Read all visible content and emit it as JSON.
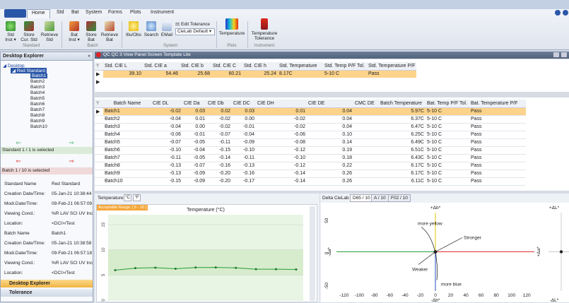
{
  "ribbon": {
    "tabs": [
      "Home",
      "Std",
      "Bat",
      "System",
      "Forms",
      "Plots",
      "Instrument"
    ],
    "buttons": {
      "std_inst": "Std\nInst ▾",
      "store_cur_std": "Store\nCur. Std",
      "retrieve_std": "Retrieve\nStd",
      "bat_inst": "Bat\nInst ▾",
      "store_bat": "Store\nBat",
      "retrieve_bat": "Retrieve\nBat",
      "illu_obs": "Illu/Obs",
      "search": "Search",
      "email": "EMail",
      "edit_tolerance": "Edit Tolerance",
      "cielab_default": "CieLab Default",
      "temperature": "Temperature",
      "temperature_tolerance": "Temperature\nTolerance"
    },
    "groups": [
      "Standard",
      "Batch",
      "System",
      "Plots",
      "Instrument"
    ],
    "colors": {
      "accent": "#2a56a8",
      "selected_row": "#fcd38a",
      "green": "#2a9d3a",
      "red": "#d33"
    }
  },
  "explorer": {
    "title": "Desktop Explorer",
    "tree": [
      "Desktop",
      "Red Standard",
      "Batch1",
      "Batch2",
      "Batch3",
      "Batch4",
      "Batch5",
      "Batch6",
      "Batch7",
      "Batch8",
      "Batch9",
      "Batch10"
    ],
    "std_status": "Standard 1 / 1 is selected",
    "batch_status": "Batch 1 / 10 is selected",
    "info": [
      {
        "label": "Standard Name",
        "value": "Red Standard"
      },
      {
        "label": "Creation Date/Time:",
        "value": "05-Jan-21 10:38:44"
      },
      {
        "label": "Modi.Date/Time:",
        "value": "09-Feb-21 06:57:09"
      },
      {
        "label": "Viewing Cond.:",
        "value": "%R LAV  SCI UV Inc"
      },
      {
        "label": "Location:",
        "value": "<DCI>/Test"
      },
      {
        "label": "Batch Name",
        "value": "Batch1"
      },
      {
        "label": "Creation Date/Time:",
        "value": "05-Jan-21 10:38:58"
      },
      {
        "label": "Modi.Date/Time:",
        "value": "09-Feb-21 06:57:18"
      },
      {
        "label": "Viewing Cond.:",
        "value": "%R LAV  SCI UV Inc"
      },
      {
        "label": "Location:",
        "value": "<DCI>/Test"
      }
    ],
    "bottom_tabs": [
      "Desktop Explorer",
      "Tolerance"
    ]
  },
  "doc": {
    "title": "QC QC 3 View Panel Screen Template Lite",
    "std_headers": [
      "Std. CIE L",
      "Std. CIE a",
      "Std. CIE b",
      "Std. CIE C",
      "Std. CIE h",
      "Std. Temperature",
      "Std. Temp P/F Tol.",
      "Std. Temperature P/F"
    ],
    "std_row": [
      "39.10",
      "54.46",
      "25.68",
      "60.21",
      "25.24",
      "8.17C",
      "5-10 C",
      "Pass"
    ],
    "batch_headers": [
      "Batch Name",
      "CIE DL",
      "CIE Da",
      "CIE Db",
      "CIE DC",
      "CIE DH",
      "CIE DE",
      "CMC DE",
      "Batch Temperature",
      "Bat. Temp P/F Tol.",
      "Bat. Temperature P/F"
    ],
    "batch_rows": [
      [
        "Batch1",
        "-0.02",
        "0.03",
        "0.02",
        "0.03",
        "0.01",
        "0.04",
        "",
        "5.97C",
        "5-10 C",
        "Pass"
      ],
      [
        "Batch2",
        "-0.04",
        "0.01",
        "-0.02",
        "0.00",
        "-0.02",
        "0.04",
        "",
        "6.37C",
        "5-10 C",
        "Pass"
      ],
      [
        "Batch3",
        "-0.04",
        "0.00",
        "-0.02",
        "-0.01",
        "-0.02",
        "0.04",
        "",
        "6.47C",
        "5-10 C",
        "Pass"
      ],
      [
        "Batch4",
        "-0.06",
        "-0.01",
        "-0.07",
        "-0.04",
        "-0.06",
        "0.10",
        "",
        "6.25C",
        "5-10 C",
        "Pass"
      ],
      [
        "Batch5",
        "-0.07",
        "-0.05",
        "-0.11",
        "-0.09",
        "-0.08",
        "0.14",
        "",
        "6.49C",
        "5-10 C",
        "Pass"
      ],
      [
        "Batch6",
        "-0.10",
        "-0.04",
        "-0.15",
        "-0.10",
        "-0.12",
        "0.19",
        "",
        "6.51C",
        "5-10 C",
        "Pass"
      ],
      [
        "Batch7",
        "-0.11",
        "-0.05",
        "-0.14",
        "-0.11",
        "-0.10",
        "0.18",
        "",
        "6.43C",
        "5-10 C",
        "Pass"
      ],
      [
        "Batch8",
        "-0.13",
        "-0.07",
        "-0.16",
        "-0.13",
        "-0.12",
        "0.22",
        "",
        "6.17C",
        "5-10 C",
        "Pass"
      ],
      [
        "Batch9",
        "-0.13",
        "-0.09",
        "-0.20",
        "-0.16",
        "-0.14",
        "0.26",
        "",
        "6.17C",
        "5-10 C",
        "Pass"
      ],
      [
        "Batch10",
        "-0.15",
        "-0.09",
        "-0.20",
        "-0.17",
        "-0.14",
        "0.26",
        "",
        "6.11C",
        "5-10 C",
        "Pass"
      ]
    ]
  },
  "temp_panel": {
    "tab": "Temperature",
    "unit_c": "°C",
    "unit_f": "°F",
    "range_label": "Acceptable Range: [ 5 - 10 ]",
    "title": "Temperature (°C)"
  },
  "delta_panel": {
    "label": "Delta CieLab",
    "tabs": [
      "D65 / 10",
      "A / 10",
      "F02 / 10"
    ],
    "plus_b": "+Δb*",
    "minus_b": "-Δb*",
    "minus_a": "-Δa*",
    "plus_a": "+Δa*",
    "plus_l": "+ΔL*",
    "minus_l": "-ΔL*",
    "more_yellow": "more yellow",
    "stronger": "Stronger",
    "weaker": "Weaker",
    "more_blue": "more blue"
  },
  "chart_data": [
    {
      "type": "line",
      "title": "Temperature (°C)",
      "x": [
        1,
        2,
        3,
        4,
        5,
        6,
        7,
        8,
        9,
        10
      ],
      "series": [
        {
          "values": [
            5.97,
            6.37,
            6.47,
            6.25,
            6.49,
            6.51,
            6.43,
            6.17,
            6.17,
            6.11
          ]
        }
      ],
      "ylim": [
        0,
        17
      ],
      "yticks": [
        "0",
        "5",
        "10",
        "15"
      ],
      "band": [
        5,
        10
      ]
    },
    {
      "type": "scatter",
      "x": [
        0.03,
        0.01,
        0.0,
        -0.01,
        -0.05,
        -0.04,
        -0.05,
        -0.07,
        -0.09,
        -0.09
      ],
      "y": [
        0.02,
        -0.02,
        -0.02,
        -0.07,
        -0.11,
        -0.15,
        -0.14,
        -0.16,
        -0.2,
        -0.2
      ],
      "xticks": [
        "-120",
        "-100",
        "-80",
        "-60",
        "-40",
        "-20",
        "0",
        "20",
        "40",
        "60",
        "80",
        "100",
        "120"
      ],
      "yticks": [
        "50",
        "0",
        "-50"
      ],
      "xlim": [
        -130,
        130
      ],
      "ylim": [
        -60,
        60
      ]
    }
  ]
}
